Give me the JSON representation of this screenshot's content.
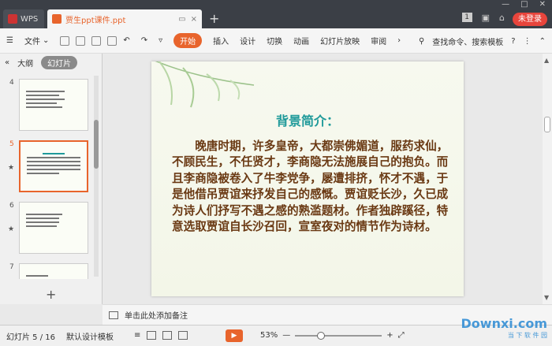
{
  "titlebar": {
    "app_tab": "WPS",
    "doc_tab": "贾生ppt课件.ppt",
    "new_tab_icon": "+",
    "badge": "1",
    "login": "未登录"
  },
  "ribbon": {
    "file": "文件",
    "tabs": [
      "开始",
      "插入",
      "设计",
      "切换",
      "动画",
      "幻灯片放映",
      "审阅"
    ],
    "search": "查找命令、搜索模板",
    "help": "?"
  },
  "sidebar": {
    "tabs": [
      "大纲",
      "幻灯片"
    ],
    "active_tab": "幻灯片",
    "thumbs": [
      {
        "num": "4",
        "star": ""
      },
      {
        "num": "5",
        "star": "★"
      },
      {
        "num": "6",
        "star": "★"
      },
      {
        "num": "7",
        "star": ""
      }
    ],
    "add_icon": "+"
  },
  "slide": {
    "title": "背景简介：",
    "body": "晚唐时期，许多皇帝，大都崇佛媚道，服药求仙，不顾民生，不任贤才，李商隐无法施展自己的抱负。而且李商隐被卷入了牛李党争，屡遭排挤，怀才不遇，于是他借吊贾谊来抒发自己的感慨。贾谊贬长沙，久已成为诗人们抒写不遇之感的熟滥题材。作者独辟蹊径，特意选取贾谊自长沙召回，宣室夜对的情节作为诗材。"
  },
  "notes": {
    "placeholder": "单击此处添加备注"
  },
  "status": {
    "slide_counter": "幻灯片 5 / 16",
    "template": "默认设计模板",
    "zoom": "53%"
  },
  "watermark": {
    "text": "Downxi.com",
    "sub": "当 下 软 件 园"
  },
  "colors": {
    "accent": "#e8642c",
    "title_teal": "#1f9a9a",
    "body_brown": "#6a3913"
  }
}
